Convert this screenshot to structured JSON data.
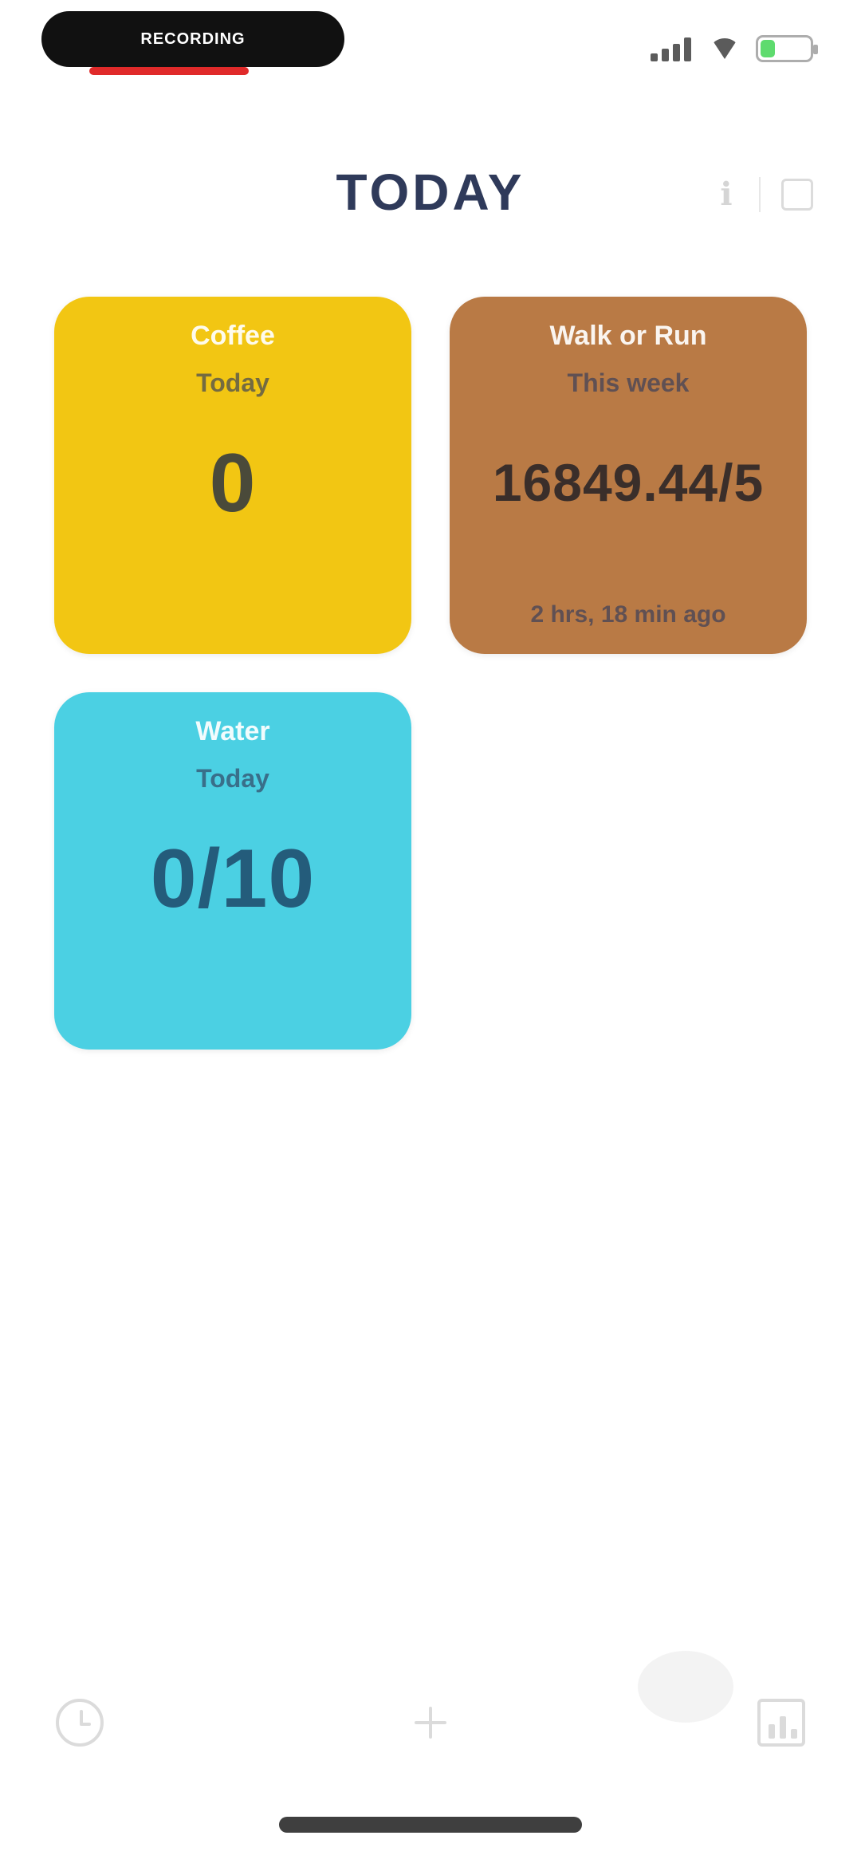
{
  "status_bar": {
    "recording_label": "RECORDING",
    "icons": [
      "signal-icon",
      "wifi-icon",
      "battery-icon"
    ],
    "battery_level": 0.3
  },
  "header": {
    "title": "TODAY",
    "actions": [
      "info-icon",
      "grid-icon"
    ]
  },
  "cards": [
    {
      "title": "Coffee",
      "subtitle": "Today",
      "value": "0",
      "footer": "",
      "color": "#F2C613"
    },
    {
      "title": "Walk or Run",
      "subtitle": "This week",
      "value": "16849.44/5",
      "footer": "2 hrs, 18 min ago",
      "color": "#B97A45"
    },
    {
      "title": "Water",
      "subtitle": "Today",
      "value": "0/10",
      "footer": "",
      "color": "#4BD0E3"
    }
  ],
  "tab_bar": {
    "icons": [
      "clock-icon",
      "plus-icon",
      "chart-icon"
    ]
  }
}
